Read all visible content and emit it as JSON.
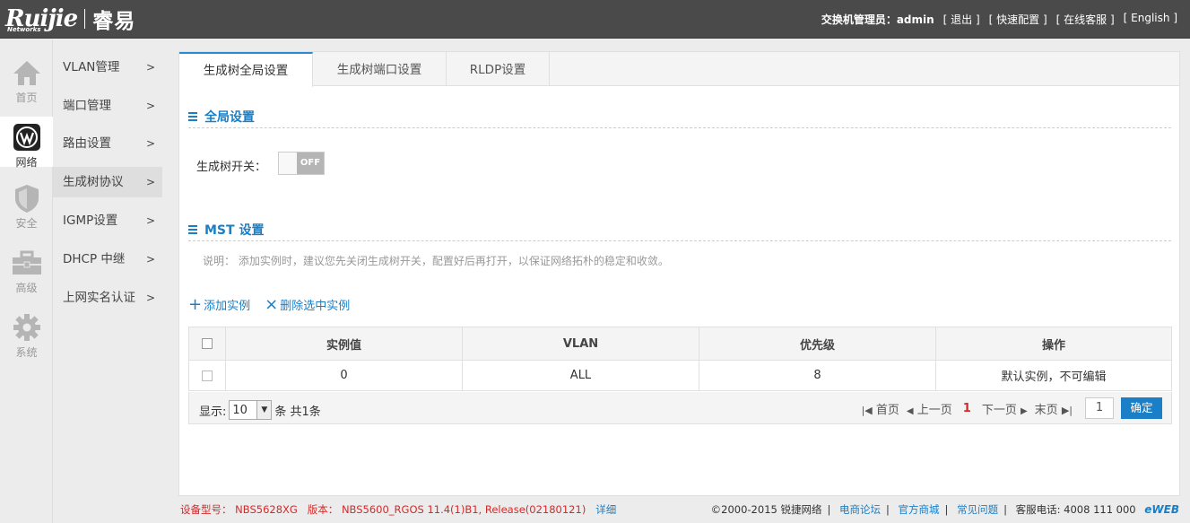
{
  "header": {
    "brand": "Ruijie",
    "brand_sub": "Networks",
    "brand_cn": "睿易",
    "admin_label": "交换机管理员：admin",
    "links": [
      "[ 退出 ]",
      "[ 快速配置 ]",
      "[ 在线客服 ]",
      "[ English ]"
    ]
  },
  "rail": [
    {
      "label": "首页",
      "icon": "home-icon"
    },
    {
      "label": "网络",
      "icon": "network-icon",
      "active": true
    },
    {
      "label": "安全",
      "icon": "shield-icon"
    },
    {
      "label": "高级",
      "icon": "toolbox-icon"
    },
    {
      "label": "系统",
      "icon": "gear-icon"
    }
  ],
  "menu": [
    {
      "label": "VLAN管理",
      "arrow": ">"
    },
    {
      "label": "端口管理",
      "arrow": ">"
    },
    {
      "label": "路由设置",
      "arrow": ">"
    },
    {
      "label": "生成树协议",
      "arrow": ">",
      "active": true
    },
    {
      "label": "IGMP设置",
      "arrow": ">"
    },
    {
      "label": "DHCP 中继",
      "arrow": ">"
    },
    {
      "label": "上网实名认证",
      "arrow": ">"
    }
  ],
  "tabs": [
    "生成树全局设置",
    "生成树端口设置",
    "RLDP设置"
  ],
  "global": {
    "title": "全局设置",
    "switch_label": "生成树开关：",
    "switch_state": "OFF"
  },
  "mst": {
    "title": "MST 设置",
    "note": "说明： 添加实例时，建议您先关闭生成树开关，配置好后再打开，以保证网络拓朴的稳定和收敛。",
    "add_label": "添加实例",
    "delete_label": "删除选中实例"
  },
  "table": {
    "headers": [
      "实例值",
      "VLAN",
      "优先级",
      "操作"
    ],
    "rows": [
      {
        "instance": "0",
        "vlan": "ALL",
        "priority": "8",
        "action": "默认实例，不可编辑"
      }
    ]
  },
  "pager": {
    "show_label": "显示:",
    "page_size": "10",
    "count_text": "条 共1条",
    "first": "首页",
    "prev": "上一页",
    "current": "1",
    "next": "下一页",
    "last": "末页",
    "page_input": "1",
    "confirm": "确定"
  },
  "footer": {
    "model_label": "设备型号：",
    "model": "NBS5628XG",
    "version_label": "版本：",
    "version": "NBS5600_RGOS 11.4(1)B1, Release(02180121)",
    "detail": "详细",
    "copyright": "©2000-2015 锐捷网络",
    "links": [
      "电商论坛",
      "官方商城",
      "常见问题"
    ],
    "hotline_label": "客服电话:",
    "hotline": "4008 111 000",
    "eweb": "eWEB"
  }
}
